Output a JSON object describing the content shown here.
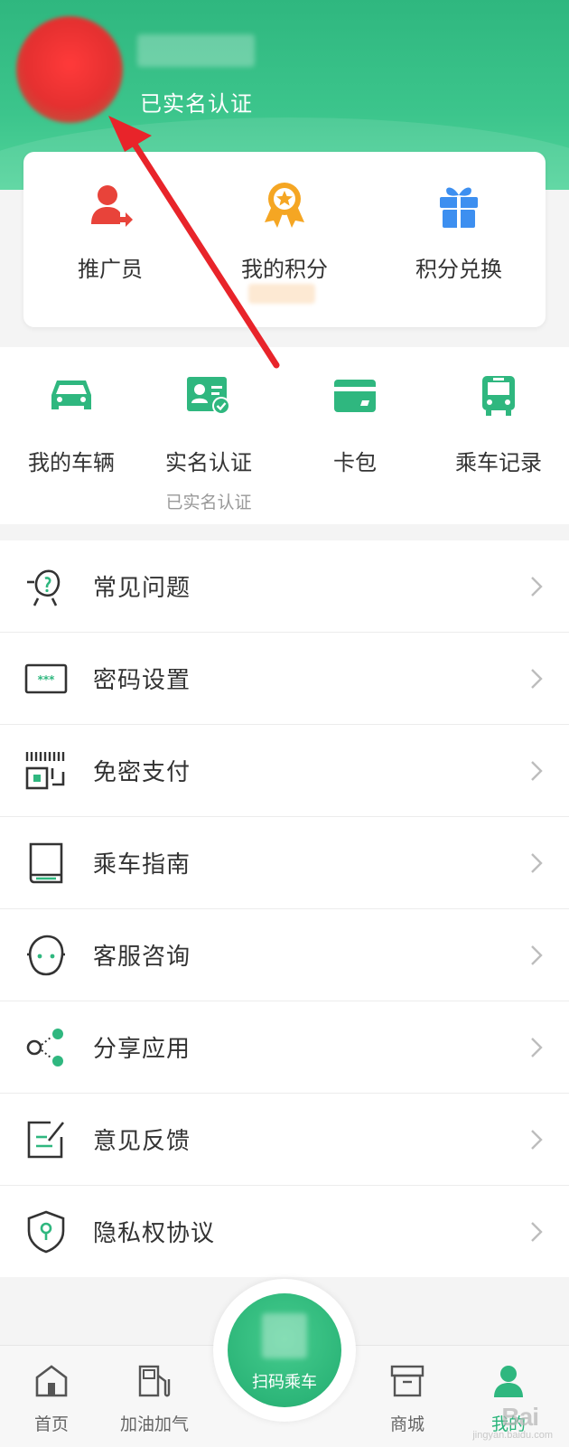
{
  "profile": {
    "verified_label": "已实名认证"
  },
  "points_card": {
    "items": [
      {
        "label": "推广员",
        "icon": "promoter-icon"
      },
      {
        "label": "我的积分",
        "icon": "medal-icon"
      },
      {
        "label": "积分兑换",
        "icon": "gift-icon"
      }
    ]
  },
  "quick_actions": {
    "items": [
      {
        "label": "我的车辆",
        "icon": "car-icon"
      },
      {
        "label": "实名认证",
        "sub": "已实名认证",
        "icon": "id-card-icon"
      },
      {
        "label": "卡包",
        "icon": "card-icon"
      },
      {
        "label": "乘车记录",
        "icon": "bus-icon"
      }
    ]
  },
  "menu": {
    "items": [
      {
        "label": "常见问题",
        "icon": "faq-icon"
      },
      {
        "label": "密码设置",
        "icon": "password-icon"
      },
      {
        "label": "免密支付",
        "icon": "barcode-icon"
      },
      {
        "label": "乘车指南",
        "icon": "guide-book-icon"
      },
      {
        "label": "客服咨询",
        "icon": "customer-service-icon"
      },
      {
        "label": "分享应用",
        "icon": "share-icon"
      },
      {
        "label": "意见反馈",
        "icon": "feedback-icon"
      },
      {
        "label": "隐私权协议",
        "icon": "privacy-shield-icon"
      }
    ]
  },
  "tabbar": {
    "home": "首页",
    "fuel": "加油加气",
    "scan": "扫码乘车",
    "mall": "商城",
    "mine": "我的"
  },
  "watermark": {
    "text": "Bai",
    "sub": "jingyan.baidu.com"
  },
  "colors": {
    "brand_green": "#2fb77f",
    "accent_red": "#e8433a",
    "icon_blue": "#3d8ff0",
    "icon_orange": "#f5a623"
  }
}
